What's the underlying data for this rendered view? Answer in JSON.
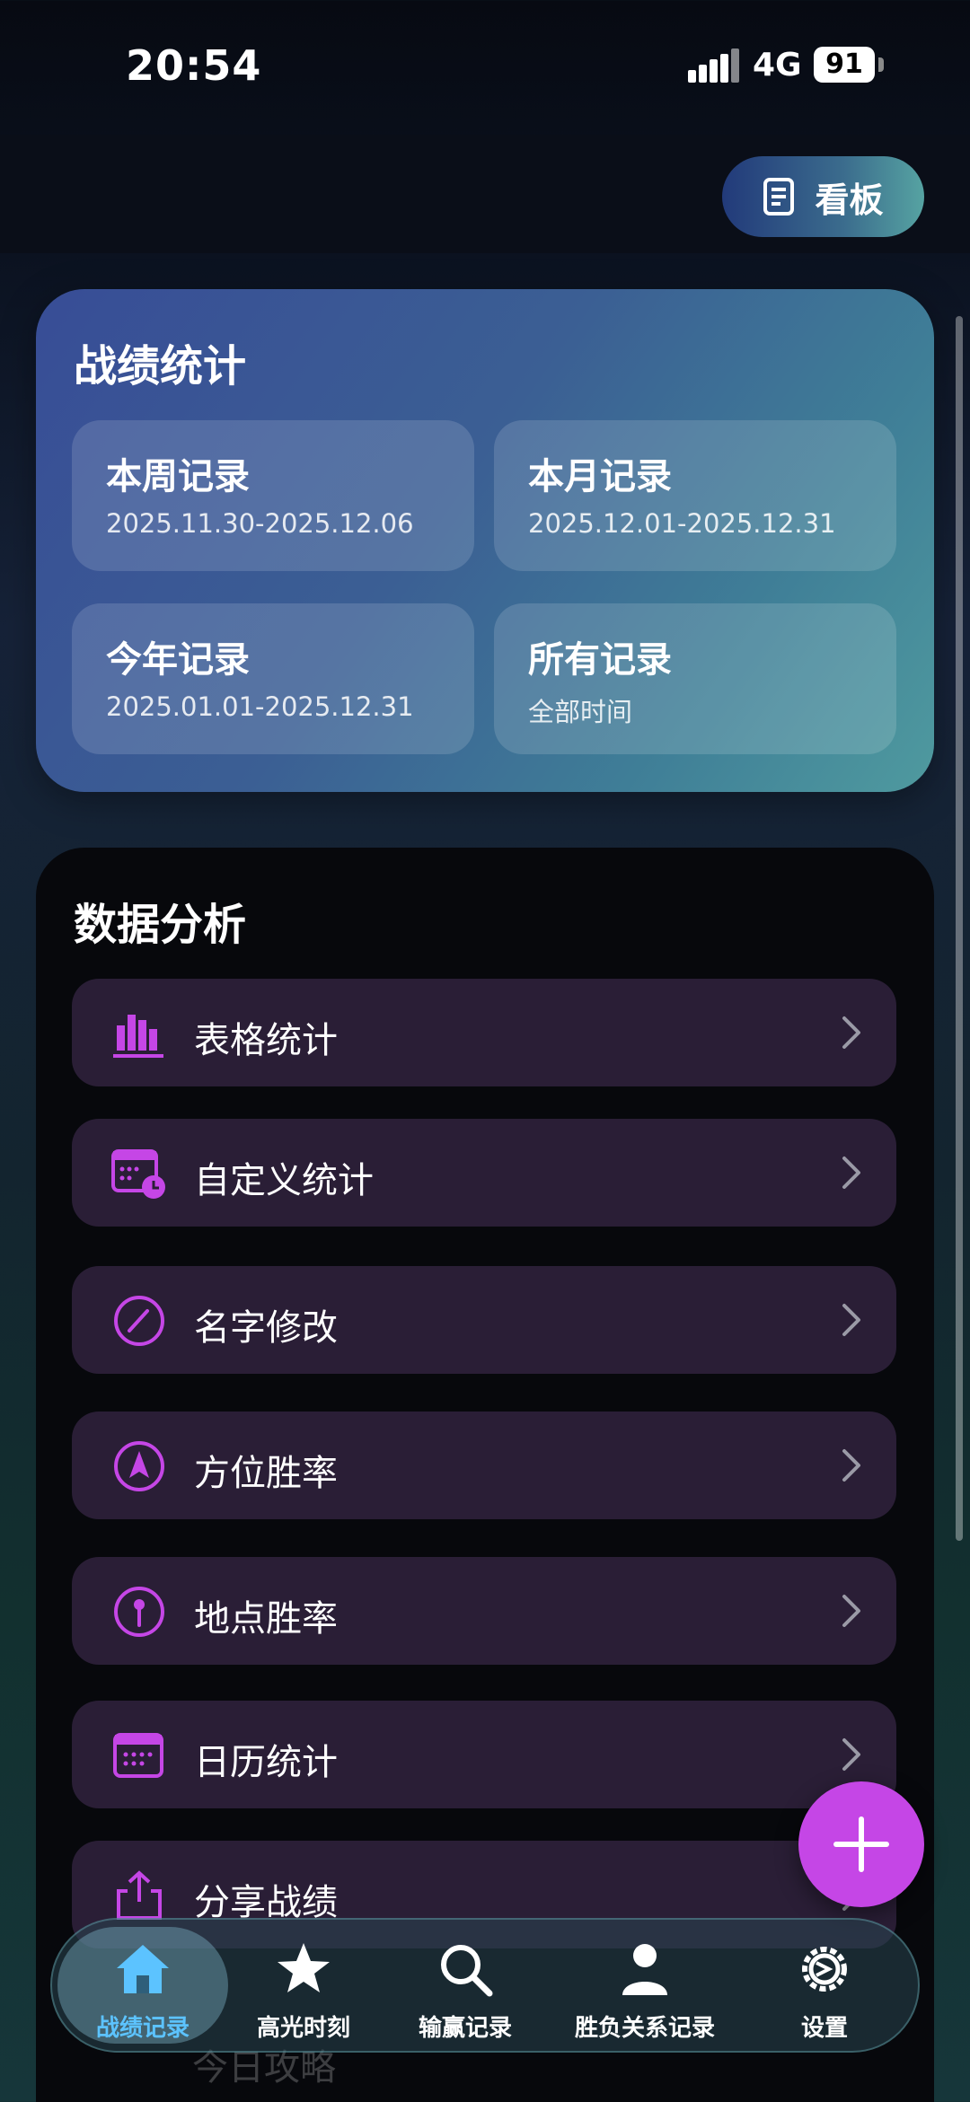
{
  "status_bar": {
    "time": "20:54",
    "network": "4G",
    "battery": "91"
  },
  "header": {
    "board_label": "看板"
  },
  "stats": {
    "title": "战绩统计",
    "tiles": [
      {
        "title": "本周记录",
        "range": "2025.11.30-2025.12.06"
      },
      {
        "title": "本月记录",
        "range": "2025.12.01-2025.12.31"
      },
      {
        "title": "今年记录",
        "range": "2025.01.01-2025.12.31"
      },
      {
        "title": "所有记录",
        "range": "全部时间"
      }
    ]
  },
  "analysis": {
    "title": "数据分析",
    "items": [
      {
        "label": "表格统计",
        "icon": "bar-chart-icon"
      },
      {
        "label": "自定义统计",
        "icon": "calendar-clock-icon"
      },
      {
        "label": "名字修改",
        "icon": "pencil-circle-icon"
      },
      {
        "label": "方位胜率",
        "icon": "navigation-arrow-icon"
      },
      {
        "label": "地点胜率",
        "icon": "location-pin-icon"
      },
      {
        "label": "日历统计",
        "icon": "calendar-icon"
      },
      {
        "label": "分享战绩",
        "icon": "share-icon"
      }
    ],
    "ghost_item": "今日攻略"
  },
  "fab": {
    "icon": "plus-icon"
  },
  "nav": {
    "items": [
      {
        "label": "战绩记录",
        "icon": "home-icon",
        "active": true
      },
      {
        "label": "高光时刻",
        "icon": "star-icon"
      },
      {
        "label": "输赢记录",
        "icon": "search-icon"
      },
      {
        "label": "胜负关系记录",
        "icon": "person-icon"
      },
      {
        "label": "设置",
        "icon": "gear-icon"
      }
    ]
  },
  "colors": {
    "accent": "#c546e6",
    "nav_active": "#5cc3ff"
  }
}
